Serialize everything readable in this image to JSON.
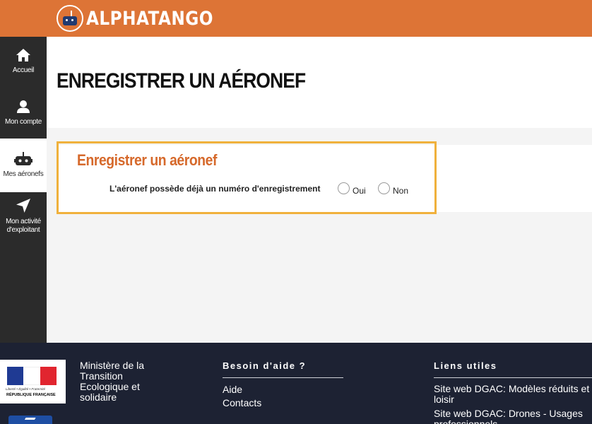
{
  "header": {
    "brand": "ALPHATANGO",
    "color": "#dd7436"
  },
  "sidebar": {
    "items": [
      {
        "label": "Accueil",
        "icon": "home-icon"
      },
      {
        "label": "Mon compte",
        "icon": "user-icon"
      },
      {
        "label": "Mes aéronefs",
        "icon": "drone-icon",
        "active": true
      },
      {
        "label": "Mon activité d'exploitant",
        "icon": "navigation-arrow-icon"
      }
    ]
  },
  "main": {
    "page_title": "ENREGISTRER UN AÉRONEF",
    "form": {
      "title": "Enregistrer un aéronef",
      "question": "L'aéronef possède déjà un numéro d'enregistrement",
      "options": [
        "Oui",
        "Non"
      ]
    },
    "accent_color": "#d6692b",
    "highlight_color": "#f0b13c"
  },
  "footer": {
    "marianne": {
      "motto": "Liberté • Égalité • Fraternité",
      "republic": "RÉPUBLIQUE FRANÇAISE"
    },
    "ministry": "Ministère de la Transition Ecologique et solidaire",
    "help": {
      "heading": "Besoin d'aide ?",
      "links": [
        "Aide",
        "Contacts"
      ]
    },
    "useful": {
      "heading": "Liens utiles",
      "links": [
        "Site web DGAC: Modèles réduits et loisir",
        "Site web DGAC: Drones - Usages professionnels"
      ]
    },
    "background": "#1d2233"
  }
}
